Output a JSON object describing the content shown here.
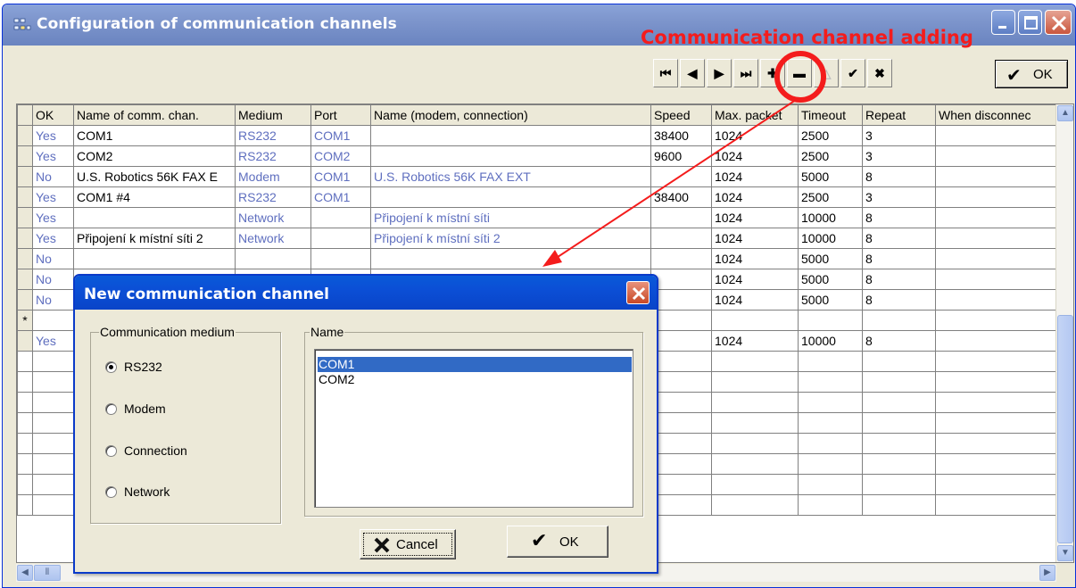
{
  "window": {
    "title": "Configuration of communication channels",
    "annotation": "Communication channel adding"
  },
  "toolbar": {
    "nav_buttons": [
      "first-icon",
      "prior-icon",
      "next-icon",
      "last-icon",
      "insert-icon",
      "delete-icon",
      "edit-icon",
      "post-icon",
      "cancel-icon"
    ],
    "ok_label": "OK"
  },
  "grid": {
    "columns": [
      "OK",
      "Name of comm. chan.",
      "Medium",
      "Port",
      "Name (modem, connection)",
      "Speed",
      "Max. packet",
      "Timeout",
      "Repeat",
      "When disconnec"
    ],
    "rows": [
      {
        "ok": "Yes",
        "name": "COM1",
        "medium": "RS232",
        "port": "COM1",
        "conn": "",
        "speed": "38400",
        "max": "1024",
        "timeout": "2500",
        "repeat": "3"
      },
      {
        "ok": "Yes",
        "name": "COM2",
        "medium": "RS232",
        "port": "COM2",
        "conn": "",
        "speed": "9600",
        "max": "1024",
        "timeout": "2500",
        "repeat": "3"
      },
      {
        "ok": "No",
        "name": "U.S. Robotics 56K FAX E",
        "medium": "Modem",
        "port": "COM1",
        "conn": "U.S. Robotics 56K FAX EXT",
        "speed": "",
        "max": "1024",
        "timeout": "5000",
        "repeat": "8"
      },
      {
        "ok": "Yes",
        "name": "COM1 #4",
        "medium": "RS232",
        "port": "COM1",
        "conn": "",
        "speed": "38400",
        "max": "1024",
        "timeout": "2500",
        "repeat": "3"
      },
      {
        "ok": "Yes",
        "name": "",
        "medium": "Network",
        "port": "",
        "conn": "Připojení k místní síti",
        "speed": "",
        "max": "1024",
        "timeout": "10000",
        "repeat": "8"
      },
      {
        "ok": "Yes",
        "name": "Připojení k místní síti 2",
        "medium": "Network",
        "port": "",
        "conn": "Připojení k místní síti 2",
        "speed": "",
        "max": "1024",
        "timeout": "10000",
        "repeat": "8"
      },
      {
        "ok": "No",
        "name": "",
        "medium": "",
        "port": "",
        "conn": "",
        "speed": "",
        "max": "1024",
        "timeout": "5000",
        "repeat": "8"
      },
      {
        "ok": "No",
        "name": "",
        "medium": "",
        "port": "",
        "conn": "",
        "speed": "",
        "max": "1024",
        "timeout": "5000",
        "repeat": "8"
      },
      {
        "ok": "No",
        "name": "",
        "medium": "",
        "port": "",
        "conn": "",
        "speed": "",
        "max": "1024",
        "timeout": "5000",
        "repeat": "8"
      },
      {
        "ok": "",
        "name": "",
        "medium": "",
        "port": "",
        "conn": "",
        "speed": "",
        "max": "",
        "timeout": "",
        "repeat": "",
        "marker": "*"
      },
      {
        "ok": "Yes",
        "name": "",
        "medium": "",
        "port": "",
        "conn": "",
        "speed": "",
        "max": "1024",
        "timeout": "10000",
        "repeat": "8"
      }
    ]
  },
  "dialog": {
    "title": "New communication channel",
    "medium_group": "Communication medium",
    "media": [
      {
        "label": "RS232",
        "selected": true
      },
      {
        "label": "Modem",
        "selected": false
      },
      {
        "label": "Connection",
        "selected": false
      },
      {
        "label": "Network",
        "selected": false
      }
    ],
    "name_group": "Name",
    "names": [
      {
        "label": "COM1",
        "selected": true
      },
      {
        "label": "COM2",
        "selected": false
      }
    ],
    "cancel_label": "Cancel",
    "ok_label": "OK"
  },
  "colors": {
    "annotation": "#f41c1c",
    "value_blue": "#5f6fbf",
    "selection": "#316ac5"
  }
}
